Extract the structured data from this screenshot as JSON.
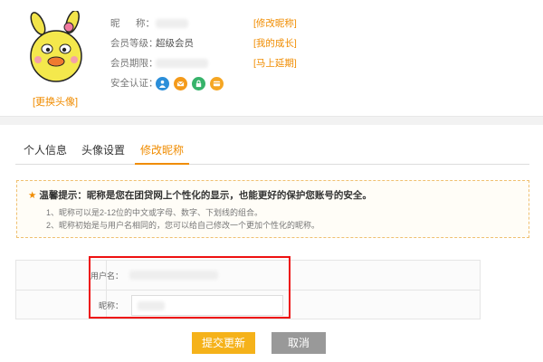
{
  "profile": {
    "change_avatar": "[更换头像]",
    "nickname_label": "昵      称：",
    "level_label": "会员等级：",
    "level_value": "超级会员",
    "expiry_label": "会员期限：",
    "auth_label": "安全认证：",
    "links": {
      "edit_nickname": "[修改昵称]",
      "my_growth": "[我的成长]",
      "extend": "[马上延期]"
    },
    "auth_icons": [
      "user-icon",
      "mail-icon",
      "lock-icon",
      "card-icon"
    ]
  },
  "tabs": [
    {
      "label": "个人信息"
    },
    {
      "label": "头像设置"
    },
    {
      "label": "修改昵称"
    }
  ],
  "notice": {
    "title": "温馨提示：昵称是您在团贷网上个性化的显示，也能更好的保护您账号的安全。",
    "line1": "1、昵称可以是2-12位的中文或字母、数字、下划线的组合。",
    "line2": "2、昵称初始是与用户名相同的，您可以给自己修改一个更加个性化的昵称。"
  },
  "form": {
    "username_label": "用户名：",
    "nickname_label": "昵称："
  },
  "buttons": {
    "submit": "提交更新",
    "cancel": "取消"
  },
  "colors": {
    "accent": "#f08c00",
    "submit": "#f5b21a",
    "cancel": "#999999",
    "highlight": "#ee1111"
  }
}
